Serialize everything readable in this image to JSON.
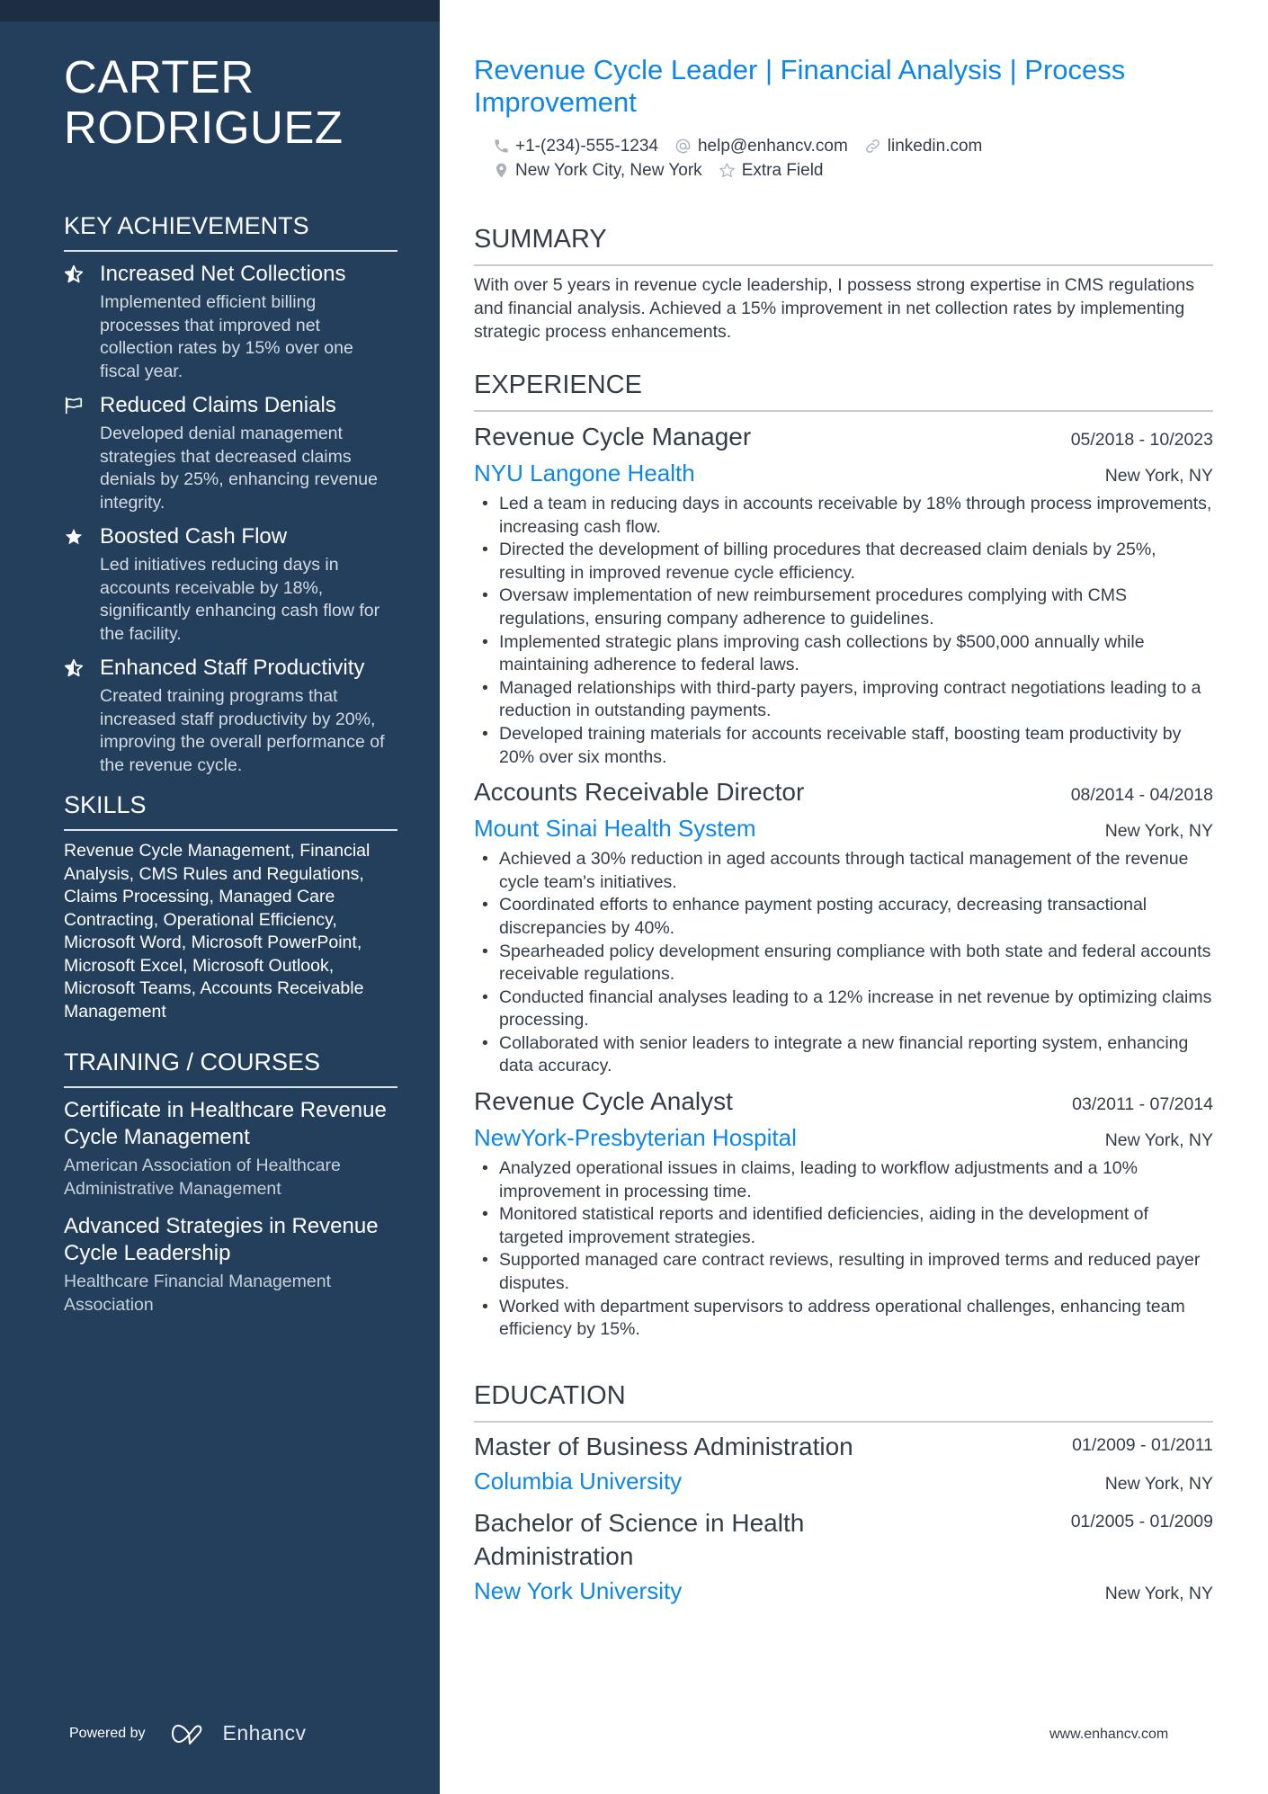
{
  "profile": {
    "name_line1": "CARTER",
    "name_line2": "RODRIGUEZ",
    "headline": "Revenue Cycle Leader | Financial Analysis | Process Improvement",
    "contacts": [
      {
        "icon": "phone-icon",
        "text": "+1-(234)-555-1234"
      },
      {
        "icon": "at-icon",
        "text": "help@enhancv.com"
      },
      {
        "icon": "link-icon",
        "text": "linkedin.com"
      },
      {
        "icon": "location-pin-icon",
        "text": "New York City, New York"
      },
      {
        "icon": "star-outline-icon",
        "text": "Extra Field"
      }
    ]
  },
  "sidebar": {
    "achievements_heading": "KEY ACHIEVEMENTS",
    "achievements": [
      {
        "icon": "star-half-icon",
        "title": "Increased Net Collections",
        "description": "Implemented efficient billing processes that improved net collection rates by 15% over one fiscal year."
      },
      {
        "icon": "flag-icon",
        "title": "Reduced Claims Denials",
        "description": "Developed denial management strategies that decreased claims denials by 25%, enhancing revenue integrity."
      },
      {
        "icon": "star-icon",
        "title": "Boosted Cash Flow",
        "description": "Led initiatives reducing days in accounts receivable by 18%, significantly enhancing cash flow for the facility."
      },
      {
        "icon": "star-half-icon",
        "title": "Enhanced Staff Productivity",
        "description": "Created training programs that increased staff productivity by 20%, improving the overall performance of the revenue cycle."
      }
    ],
    "skills_heading": "SKILLS",
    "skills_text": "Revenue Cycle Management, Financial Analysis, CMS Rules and Regulations, Claims Processing, Managed Care Contracting, Operational Efficiency, Microsoft Word, Microsoft PowerPoint, Microsoft Excel, Microsoft Outlook, Microsoft Teams, Accounts Receivable Management",
    "training_heading": "TRAINING / COURSES",
    "courses": [
      {
        "title": "Certificate in Healthcare Revenue Cycle Management",
        "org": "American Association of Healthcare Administrative Management"
      },
      {
        "title": "Advanced Strategies in Revenue Cycle Leadership",
        "org": "Healthcare Financial Management Association"
      }
    ],
    "powered_by": "Powered by",
    "brand": "Enhancv"
  },
  "summary": {
    "heading": "SUMMARY",
    "text": "With over 5 years in revenue cycle leadership, I possess strong expertise in CMS regulations and financial analysis. Achieved a 15% improvement in net collection rates by implementing strategic process enhancements."
  },
  "experience": {
    "heading": "EXPERIENCE",
    "jobs": [
      {
        "title": "Revenue Cycle Manager",
        "dates": "05/2018 - 10/2023",
        "company": "NYU Langone Health",
        "location": "New York, NY",
        "bullets": [
          "Led a team in reducing days in accounts receivable by 18% through process improvements, increasing cash flow.",
          "Directed the development of billing procedures that decreased claim denials by 25%, resulting in improved revenue cycle efficiency.",
          "Oversaw implementation of new reimbursement procedures complying with CMS regulations, ensuring company adherence to guidelines.",
          "Implemented strategic plans improving cash collections by $500,000 annually while maintaining adherence to federal laws.",
          "Managed relationships with third-party payers, improving contract negotiations leading to a reduction in outstanding payments.",
          "Developed training materials for accounts receivable staff, boosting team productivity by 20% over six months."
        ]
      },
      {
        "title": "Accounts Receivable Director",
        "dates": "08/2014 - 04/2018",
        "company": "Mount Sinai Health System",
        "location": "New York, NY",
        "bullets": [
          "Achieved a 30% reduction in aged accounts through tactical management of the revenue cycle team's initiatives.",
          "Coordinated efforts to enhance payment posting accuracy, decreasing transactional discrepancies by 40%.",
          "Spearheaded policy development ensuring compliance with both state and federal accounts receivable regulations.",
          "Conducted financial analyses leading to a 12% increase in net revenue by optimizing claims processing.",
          "Collaborated with senior leaders to integrate a new financial reporting system, enhancing data accuracy."
        ]
      },
      {
        "title": "Revenue Cycle Analyst",
        "dates": "03/2011 - 07/2014",
        "company": "NewYork-Presbyterian Hospital",
        "location": "New York, NY",
        "bullets": [
          "Analyzed operational issues in claims, leading to workflow adjustments and a 10% improvement in processing time.",
          "Monitored statistical reports and identified deficiencies, aiding in the development of targeted improvement strategies.",
          "Supported managed care contract reviews, resulting in improved terms and reduced payer disputes.",
          "Worked with department supervisors to address operational challenges, enhancing team efficiency by 15%."
        ]
      }
    ]
  },
  "education": {
    "heading": "EDUCATION",
    "items": [
      {
        "degree": "Master of Business Administration",
        "dates": "01/2009 - 01/2011",
        "school": "Columbia University",
        "location": "New York, NY"
      },
      {
        "degree": "Bachelor of Science in Health Administration",
        "dates": "01/2005 - 01/2009",
        "school": "New York University",
        "location": "New York, NY"
      }
    ]
  },
  "footer": {
    "url": "www.enhancv.com"
  },
  "colors": {
    "sidebar_bg": "#233f5c",
    "accent": "#0d86e8",
    "text": "#333d47"
  }
}
